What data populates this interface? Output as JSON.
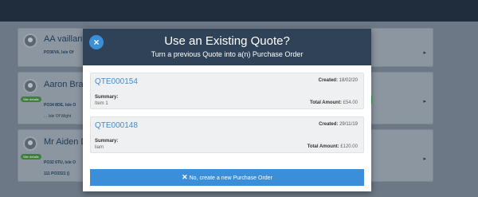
{
  "background": {
    "cards": [
      {
        "name": "AA vaillant",
        "address": "PO36YA, Isle Of",
        "sub": "",
        "badge": ""
      },
      {
        "name": "Aaron Brad",
        "address": "PO34 8DE, Isle O",
        "sub": "... Isle Of Wight",
        "badge": "Site details"
      },
      {
        "name": "Mr Aiden D",
        "address": "PO32 6TU, Isle O",
        "sub": "111   PO3321 ()",
        "badge": "Site details"
      }
    ]
  },
  "modal": {
    "close_icon": "×",
    "title": "Use an Existing Quote?",
    "subtitle": "Turn a previous Quote into a(n) Purchase Order",
    "quotes": [
      {
        "ref": "QTE000154",
        "created_label": "Created:",
        "created": "18/02/20",
        "summary_label": "Summary:",
        "summary": "Item 1",
        "total_label": "Total Amount:",
        "total": "£54.00"
      },
      {
        "ref": "QTE000148",
        "created_label": "Created:",
        "created": "29/11/19",
        "summary_label": "Summary:",
        "summary": "liam",
        "total_label": "Total Amount:",
        "total": "£120.00"
      }
    ],
    "new_po_icon": "✕",
    "new_po_label": "No, create a new Purchase Order"
  },
  "colors": {
    "accent": "#3b8fd9",
    "header": "#2f4257"
  }
}
